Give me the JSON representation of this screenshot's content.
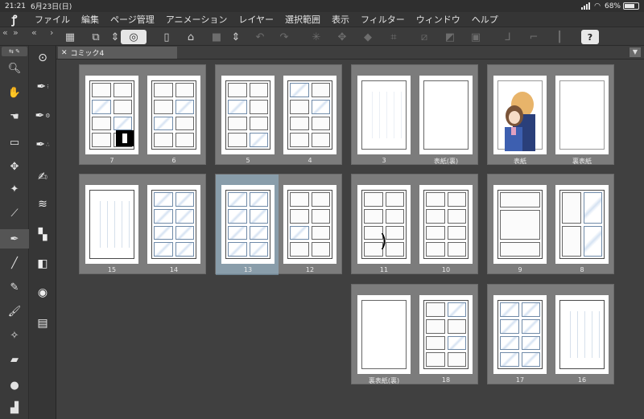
{
  "status_bar": {
    "time": "21:21",
    "date": "6月23日(日)",
    "battery": "68%",
    "battery_level": 0.68
  },
  "menu": {
    "items": [
      "ファイル",
      "編集",
      "ページ管理",
      "アニメーション",
      "レイヤー",
      "選択範囲",
      "表示",
      "フィルター",
      "ウィンドウ",
      "ヘルプ"
    ]
  },
  "toolbar": {
    "help_label": "?"
  },
  "document": {
    "tab_title": "コミック4"
  },
  "spreads": [
    {
      "pages": [
        {
          "label": "7"
        },
        {
          "label": "6"
        }
      ]
    },
    {
      "pages": [
        {
          "label": "5"
        },
        {
          "label": "4"
        }
      ]
    },
    {
      "pages": [
        {
          "label": "3"
        },
        {
          "label": "表紙(裏)"
        }
      ]
    },
    {
      "pages": [
        {
          "label": "表紙"
        },
        {
          "label": "裏表紙"
        }
      ]
    },
    {
      "pages": [
        {
          "label": "15"
        },
        {
          "label": "14"
        }
      ]
    },
    {
      "pages": [
        {
          "label": "13"
        },
        {
          "label": "12"
        }
      ]
    },
    {
      "pages": [
        {
          "label": "11"
        },
        {
          "label": "10"
        }
      ]
    },
    {
      "pages": [
        {
          "label": "9"
        },
        {
          "label": "8"
        }
      ]
    },
    {
      "pages": [
        {
          "label": "裏表紙(裏)"
        },
        {
          "label": "18"
        }
      ]
    },
    {
      "pages": [
        {
          "label": "17"
        },
        {
          "label": "16"
        }
      ]
    }
  ],
  "colors": {
    "background": "#434343",
    "spread_background": "#7c7c7c",
    "selection": "#a8c8dc"
  }
}
